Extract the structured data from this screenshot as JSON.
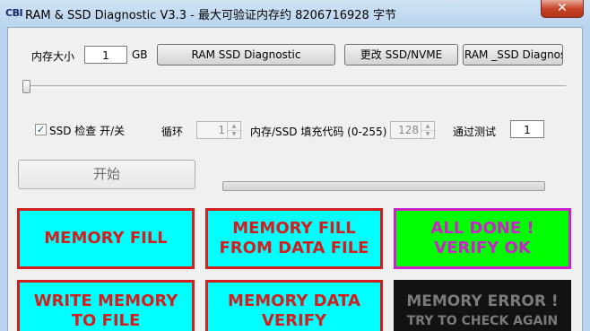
{
  "titlebar": {
    "icon_text": "CBI",
    "title": "RAM & SSD Diagnostic V3.3 - 最大可验证内存约 8206716928 字节",
    "close_glyph": "✕"
  },
  "memory": {
    "label": "内存大小",
    "value": "1",
    "unit": "GB"
  },
  "buttons": {
    "ram_ssd_diagnostic": "RAM  SSD Diagnostic",
    "change_ssd_nvme": "更改 SSD/NVME",
    "ram_ssd_diagnos_truncated": "RAM _SSD Diagnos",
    "start": "开始"
  },
  "slider": {
    "level": 0
  },
  "options": {
    "ssd_check_label": "SSD 检查 开/关",
    "ssd_check_checked": true,
    "loop_label": "循环",
    "loop_value": "1",
    "fill_code_label": "内存/SSD 填充代码 (0-255)",
    "fill_code_value": "128",
    "pass_test_label": "通过测试",
    "pass_test_value": "1"
  },
  "progress": {
    "value": 0
  },
  "status_panels": [
    {
      "name": "memory-fill-panel",
      "lines": [
        "MEMORY FILL"
      ],
      "bg": "#00ffff",
      "border": "#d11f1f",
      "color": "#d11f1f"
    },
    {
      "name": "memory-fill-from-data-file-panel",
      "lines": [
        "MEMORY FILL",
        "FROM DATA FILE"
      ],
      "bg": "#00ffff",
      "border": "#d11f1f",
      "color": "#d11f1f"
    },
    {
      "name": "all-done-verify-ok-panel",
      "lines": [
        "ALL DONE !",
        "VERIFY OK"
      ],
      "bg": "#00ff00",
      "border": "#cc22cc",
      "color": "#cc22cc"
    },
    {
      "name": "write-memory-to-file-panel",
      "lines": [
        "WRITE MEMORY",
        "TO FILE"
      ],
      "bg": "#00ffff",
      "border": "#d11f1f",
      "color": "#d11f1f"
    },
    {
      "name": "memory-data-verify-panel",
      "lines": [
        "MEMORY DATA",
        "VERIFY"
      ],
      "bg": "#00ffff",
      "border": "#d11f1f",
      "color": "#d11f1f"
    },
    {
      "name": "memory-error-panel",
      "lines": [
        "MEMORY ERROR !",
        "TRY TO CHECK AGAIN"
      ],
      "bg": "#121212",
      "border": "#121212",
      "color": "#7a7a7a"
    }
  ]
}
